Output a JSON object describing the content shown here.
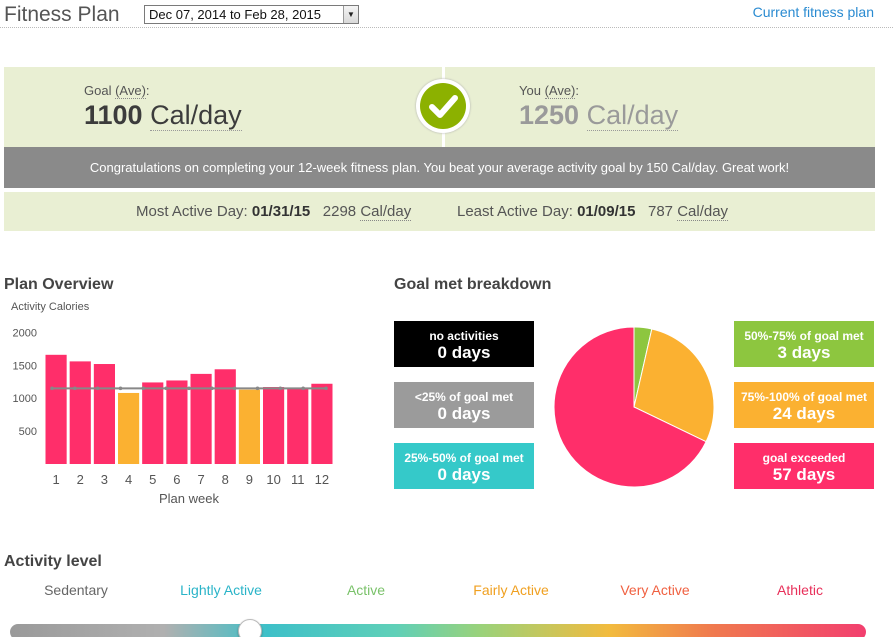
{
  "header": {
    "title": "Fitness Plan",
    "date_range": "Dec 07, 2014 to Feb 28, 2015",
    "current_plan_link": "Current fitness plan"
  },
  "goal": {
    "goal_label": "Goal",
    "goal_ave": "(Ave)",
    "goal_value": "1100",
    "you_label": "You",
    "you_ave": "(Ave)",
    "you_value": "1250",
    "unit": "Cal/day"
  },
  "congrats": "Congratulations on completing your 12-week fitness plan. You beat your average activity goal by 150 Cal/day. Great work!",
  "active_days": {
    "most_label": "Most Active Day:",
    "most_date": "01/31/15",
    "most_value": "2298",
    "least_label": "Least Active Day:",
    "least_date": "01/09/15",
    "least_value": "787",
    "unit": "Cal/day"
  },
  "plan_overview": {
    "title": "Plan Overview"
  },
  "chart_data": {
    "type": "bar",
    "ylabel": "Activity Calories",
    "xlabel": "Plan week",
    "categories": [
      "1",
      "2",
      "3",
      "4",
      "5",
      "6",
      "7",
      "8",
      "9",
      "10",
      "11",
      "12"
    ],
    "values": [
      1660,
      1560,
      1520,
      1080,
      1240,
      1270,
      1370,
      1440,
      1130,
      1170,
      1150,
      1220
    ],
    "bar_colors": [
      "#ff2e6a",
      "#ff2e6a",
      "#ff2e6a",
      "#fbb131",
      "#ff2e6a",
      "#ff2e6a",
      "#ff2e6a",
      "#ff2e6a",
      "#fbb131",
      "#ff2e6a",
      "#ff2e6a",
      "#ff2e6a"
    ],
    "goal_line": 1150,
    "yticks": [
      500,
      1000,
      1500,
      2000
    ],
    "ylim": [
      0,
      2250
    ]
  },
  "breakdown": {
    "title": "Goal met breakdown",
    "boxes": [
      {
        "label": "no activities",
        "days": "0 days",
        "color": "#000000"
      },
      {
        "label": "<25% of goal met",
        "days": "0 days",
        "color": "#9b9b9b"
      },
      {
        "label": "25%-50% of goal met",
        "days": "0 days",
        "color": "#35c9c9"
      },
      {
        "label": "50%-75% of goal met",
        "days": "3 days",
        "color": "#8dc63f"
      },
      {
        "label": "75%-100% of goal met",
        "days": "24 days",
        "color": "#fbb131"
      },
      {
        "label": "goal exceeded",
        "days": "57 days",
        "color": "#ff2e6a"
      }
    ],
    "pie": [
      {
        "name": "50%-75% of goal met",
        "value": 3,
        "color": "#8dc63f"
      },
      {
        "name": "75%-100% of goal met",
        "value": 24,
        "color": "#fbb131"
      },
      {
        "name": "goal exceeded",
        "value": 57,
        "color": "#ff2e6a"
      }
    ]
  },
  "activity_level": {
    "title": "Activity level",
    "levels": [
      {
        "label": "Sedentary",
        "color": "#666666"
      },
      {
        "label": "Lightly Active",
        "color": "#2ab4c8"
      },
      {
        "label": "Active",
        "color": "#7ac26a"
      },
      {
        "label": "Fairly Active",
        "color": "#f0a020"
      },
      {
        "label": "Very Active",
        "color": "#f06040"
      },
      {
        "label": "Athletic",
        "color": "#e8305a"
      }
    ],
    "slider_fraction": 0.28
  }
}
